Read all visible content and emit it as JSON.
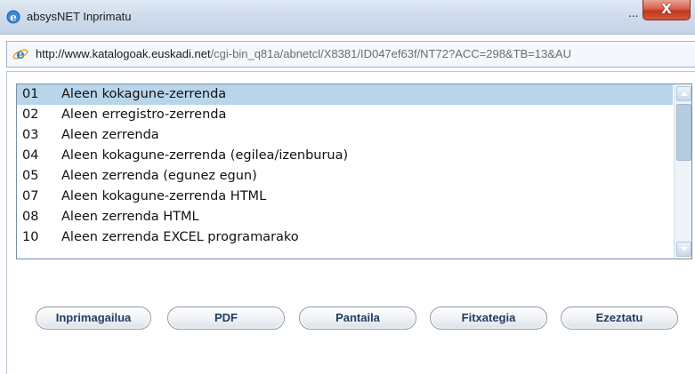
{
  "window": {
    "title": "absysNET Inprimatu",
    "minimize_label": "...",
    "close_label": "X"
  },
  "address": {
    "host": "http://www.katalogoak.euskadi.net",
    "path": "/cgi-bin_q81a/abnetcl/X8381/ID047ef63f/NT72?ACC=298&TB=13&AU"
  },
  "list": {
    "selected_index": 0,
    "items": [
      {
        "num": "01",
        "label": "Aleen kokagune-zerrenda"
      },
      {
        "num": "02",
        "label": "Aleen erregistro-zerrenda"
      },
      {
        "num": "03",
        "label": "Aleen zerrenda"
      },
      {
        "num": "04",
        "label": "Aleen kokagune-zerrenda (egilea/izenburua)"
      },
      {
        "num": "05",
        "label": "Aleen zerrenda (egunez egun)"
      },
      {
        "num": "07",
        "label": "Aleen kokagune-zerrenda HTML"
      },
      {
        "num": "08",
        "label": "Aleen zerrenda HTML"
      },
      {
        "num": "10",
        "label": "Aleen zerrenda EXCEL programarako"
      }
    ]
  },
  "buttons": {
    "printer": "Inprimagailua",
    "pdf": "PDF",
    "screen": "Pantaila",
    "file": "Fitxategia",
    "cancel": "Ezeztatu"
  },
  "colors": {
    "selection": "#b9d5ea",
    "button_text": "#1f3c66",
    "close_button": "#c9452a"
  }
}
